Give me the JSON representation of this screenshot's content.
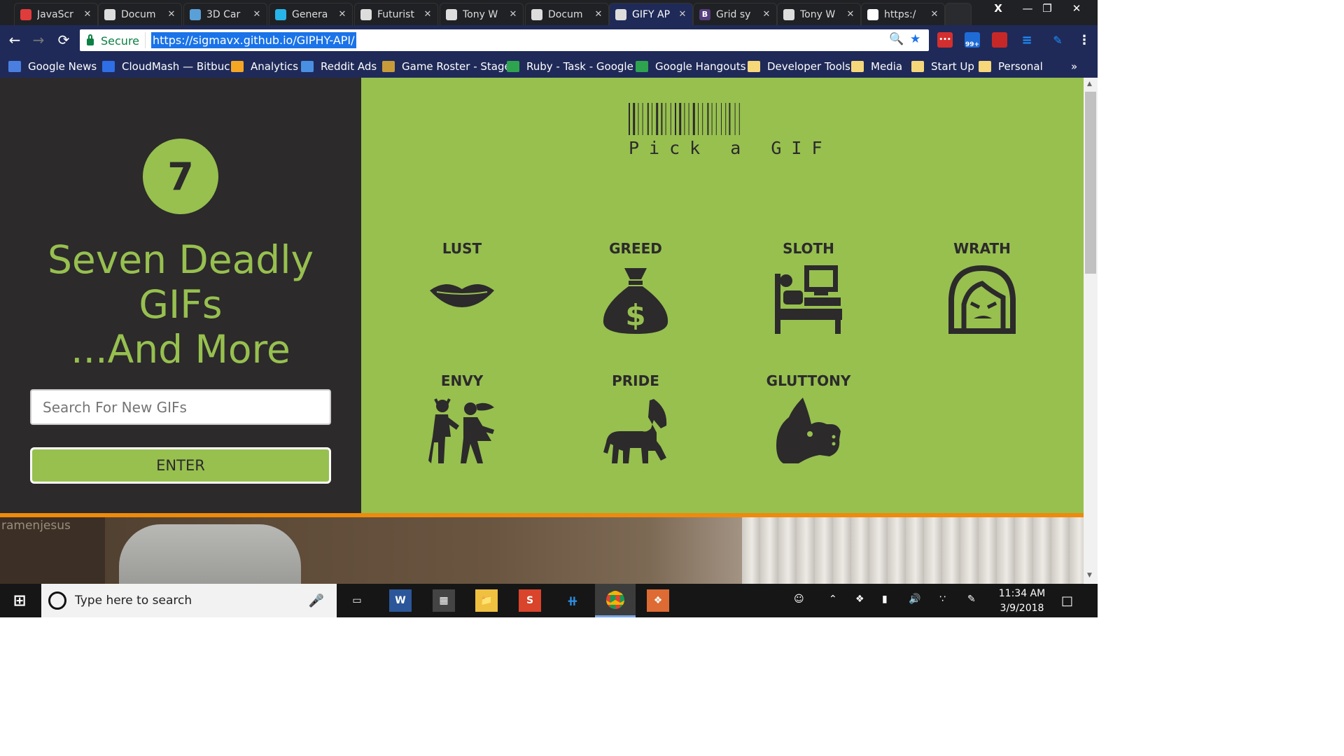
{
  "browser": {
    "tabs": [
      {
        "title": "JavaScr",
        "icon": "js-tab-icon",
        "color": "#e03c3c"
      },
      {
        "title": "Docum",
        "icon": "doc-tab-icon",
        "color": "#ddd"
      },
      {
        "title": "3D Car",
        "icon": "image-tab-icon",
        "color": "#5aa0d8"
      },
      {
        "title": "Genera",
        "icon": "generator-tab-icon",
        "color": "#27b4e8"
      },
      {
        "title": "Futurist",
        "icon": "camera-tab-icon",
        "color": "#ddd"
      },
      {
        "title": "Tony W",
        "icon": "doc-tab-icon",
        "color": "#ddd"
      },
      {
        "title": "Docum",
        "icon": "doc-tab-icon",
        "color": "#ddd"
      },
      {
        "title": "GIFY AP",
        "icon": "doc-tab-icon",
        "color": "#ddd"
      },
      {
        "title": "Grid sy",
        "icon": "bootstrap-tab-icon",
        "color": "#563d7c"
      },
      {
        "title": "Tony W",
        "icon": "doc-tab-icon",
        "color": "#ddd"
      },
      {
        "title": "https:/",
        "icon": "github-tab-icon",
        "color": "#fff"
      }
    ],
    "profile_letter": "X",
    "secure_label": "Secure",
    "url": "https://sigmavx.github.io/GIPHY-API/",
    "extension_badge": "99+",
    "bookmarks": [
      {
        "label": "Google News",
        "color": "#4a7fe0",
        "folder": false
      },
      {
        "label": "CloudMash — Bitbuc",
        "color": "#2f6fe6",
        "folder": false
      },
      {
        "label": "Analytics",
        "color": "#f5a623",
        "folder": false
      },
      {
        "label": "Reddit Ads",
        "color": "#4a90e2",
        "folder": false
      },
      {
        "label": "Game Roster - Stage",
        "color": "#c89b3a",
        "folder": false
      },
      {
        "label": "Ruby - Task - Google",
        "color": "#2ea44f",
        "folder": false
      },
      {
        "label": "Google Hangouts",
        "color": "#2ea44f",
        "folder": false
      },
      {
        "label": "Developer Tools",
        "color": "#f6d77a",
        "folder": true
      },
      {
        "label": "Media",
        "color": "#f6d77a",
        "folder": true
      },
      {
        "label": "Start Up",
        "color": "#f6d77a",
        "folder": true
      },
      {
        "label": "Personal",
        "color": "#f6d77a",
        "folder": true
      }
    ],
    "bookmark_overflow": "»"
  },
  "page": {
    "logo_number": "7",
    "title_line1": "Seven Deadly",
    "title_line2": "GIFs",
    "title_line3": "...And More",
    "search_placeholder": "Search For New GIFs",
    "enter_label": "ENTER",
    "pick_label": "Pick a GIF",
    "sins": [
      "LUST",
      "GREED",
      "SLOTH",
      "WRATH",
      "ENVY",
      "PRIDE",
      "GLUTTONY"
    ],
    "gif_watermark": "ramenjesus",
    "colors": {
      "accent": "#97c04f",
      "dark": "#2c2a2b",
      "orange": "#ef8a0a"
    }
  },
  "taskbar": {
    "search_text": "Type here to search",
    "time": "11:34 AM",
    "date": "3/9/2018"
  }
}
